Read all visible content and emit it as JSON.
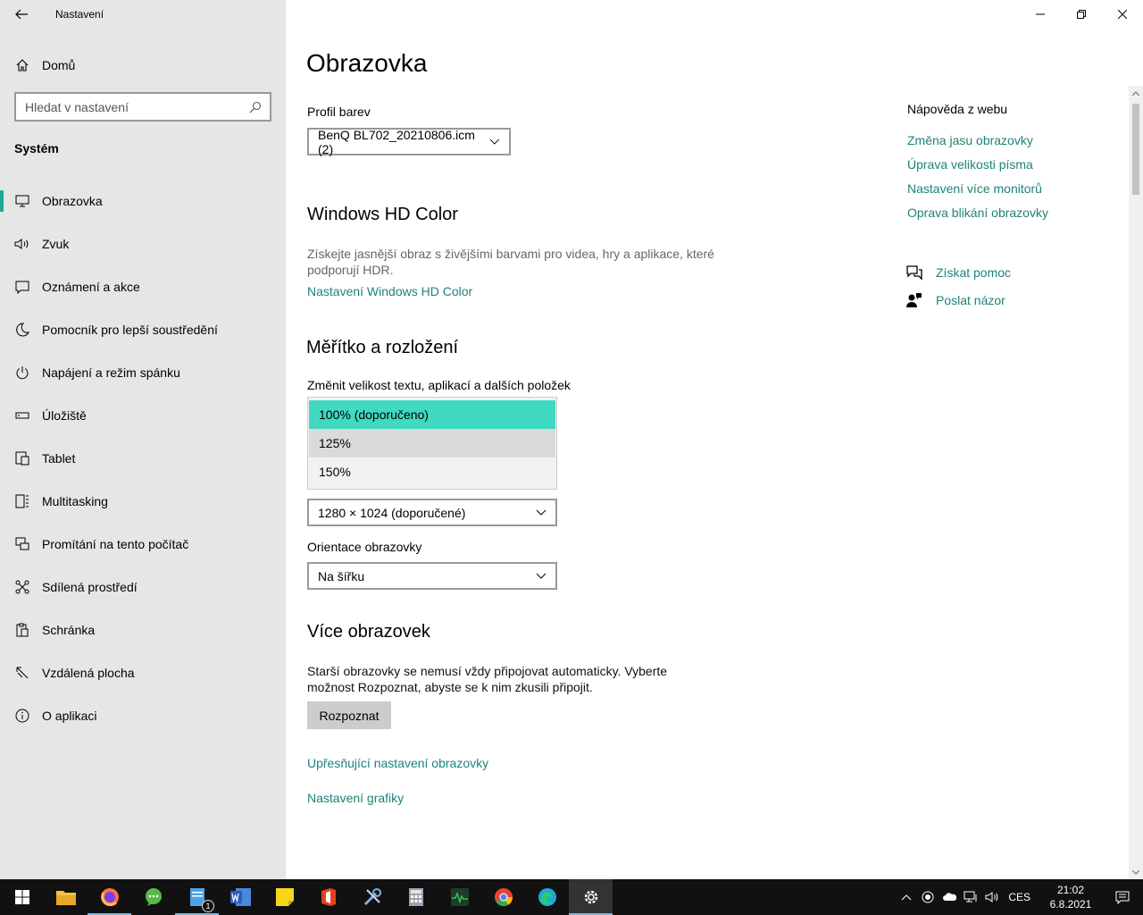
{
  "window": {
    "app_title": "Nastavení"
  },
  "sidebar": {
    "home_label": "Domů",
    "search_placeholder": "Hledat v nastavení",
    "section_title": "Systém",
    "items": [
      {
        "label": "Obrazovka",
        "icon": "monitor-icon",
        "active": true
      },
      {
        "label": "Zvuk",
        "icon": "speaker-icon"
      },
      {
        "label": "Oznámení a akce",
        "icon": "notification-icon"
      },
      {
        "label": "Pomocník pro lepší soustředění",
        "icon": "moon-icon"
      },
      {
        "label": "Napájení a režim spánku",
        "icon": "power-icon"
      },
      {
        "label": "Úložiště",
        "icon": "storage-icon"
      },
      {
        "label": "Tablet",
        "icon": "tablet-icon"
      },
      {
        "label": "Multitasking",
        "icon": "multitasking-icon"
      },
      {
        "label": "Promítání na tento počítač",
        "icon": "projecting-icon"
      },
      {
        "label": "Sdílená prostředí",
        "icon": "shared-experiences-icon"
      },
      {
        "label": "Schránka",
        "icon": "clipboard-icon"
      },
      {
        "label": "Vzdálená plocha",
        "icon": "remote-desktop-icon"
      },
      {
        "label": "O aplikaci",
        "icon": "info-icon"
      }
    ]
  },
  "main": {
    "title": "Obrazovka",
    "color_profile": {
      "label": "Profil barev",
      "value": "BenQ BL702_20210806.icm (2)"
    },
    "hd_color": {
      "heading": "Windows HD Color",
      "description": "Získejte jasnější obraz s živějšími barvami pro videa, hry a aplikace, které podporují HDR.",
      "link": "Nastavení Windows HD Color"
    },
    "scale": {
      "heading": "Měřítko a rozložení",
      "label": "Změnit velikost textu, aplikací a dalších položek",
      "options": [
        "100% (doporučeno)",
        "125%",
        "150%"
      ],
      "selected_option": "100% (doporučeno)",
      "hovered_option": "125%",
      "resolution_value": "1280 × 1024 (doporučené)",
      "orientation_label": "Orientace obrazovky",
      "orientation_value": "Na šířku"
    },
    "multi": {
      "heading": "Více obrazovek",
      "description": "Starší obrazovky se nemusí vždy připojovat automaticky. Vyberte možnost Rozpoznat, abyste se k nim zkusili připojit.",
      "detect_button": "Rozpoznat"
    },
    "advanced_link": "Upřesňující nastavení obrazovky",
    "graphics_link": "Nastavení grafiky"
  },
  "help": {
    "title": "Nápověda z webu",
    "links": [
      "Změna jasu obrazovky",
      "Úprava velikosti písma",
      "Nastavení více monitorů",
      "Oprava blikání obrazovky"
    ],
    "get_help": "Získat pomoc",
    "feedback": "Poslat názor"
  },
  "taskbar": {
    "apps": [
      {
        "name": "file-explorer-icon",
        "color": "#f5c242"
      },
      {
        "name": "firefox-icon",
        "color": "#ff7139"
      },
      {
        "name": "messenger-icon",
        "color": "#58b947"
      },
      {
        "name": "notepad-icon",
        "color": "#4aa3e8",
        "badge": "1"
      },
      {
        "name": "word-icon",
        "color": "#2b5eb8"
      },
      {
        "name": "sticky-notes-icon",
        "color": "#f7d51d"
      },
      {
        "name": "office-icon",
        "color": "#e3421c"
      },
      {
        "name": "tools-icon",
        "color": "#7fb0d8"
      },
      {
        "name": "calculator-icon",
        "color": "#9aa3ad"
      },
      {
        "name": "resource-monitor-icon",
        "color": "#39c552"
      },
      {
        "name": "chrome-icon",
        "color": "#e94235"
      },
      {
        "name": "edge-icon",
        "color": "#1fa7d8"
      },
      {
        "name": "settings-icon",
        "color": "#ffffff"
      }
    ],
    "language": "CES",
    "time": "21:02",
    "date": "6.8.2021"
  },
  "colors": {
    "accent": "#1e8376",
    "selection": "#40d9c2",
    "sidebar_bg": "#e6e6e6",
    "taskbar_bg": "#111111"
  }
}
